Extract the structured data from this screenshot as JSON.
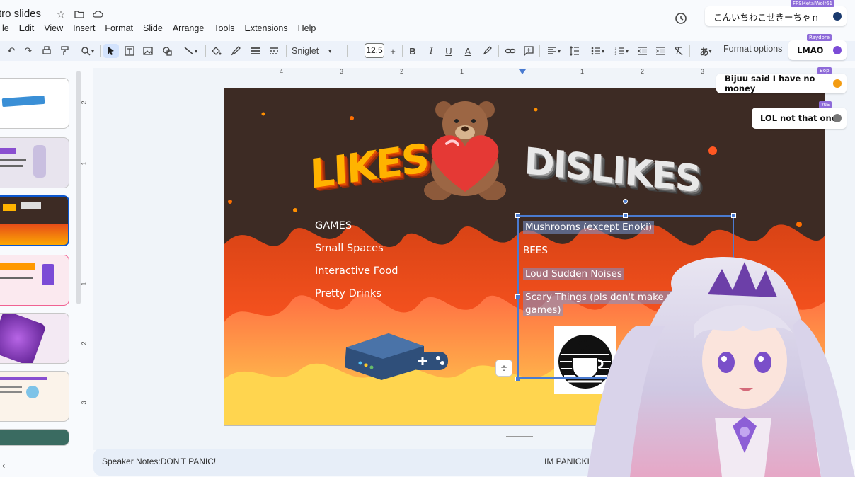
{
  "app": {
    "doc_title": "tro slides",
    "menu": [
      "le",
      "Edit",
      "View",
      "Insert",
      "Format",
      "Slide",
      "Arrange",
      "Tools",
      "Extensions",
      "Help"
    ]
  },
  "toolbar": {
    "font_name": "Sniglet",
    "font_size": "12.5",
    "format_options": "Format options",
    "input_tool_glyph": "あ"
  },
  "ruler": {
    "top_ticks": [
      "4",
      "3",
      "2",
      "1",
      "1",
      "2",
      "3"
    ],
    "left_ticks": [
      "2",
      "1",
      "1",
      "2",
      "3"
    ]
  },
  "slide": {
    "likes_title": "LIKES",
    "dislikes_title": "DISLIKES",
    "likes": [
      "GAMES",
      "Small Spaces",
      "Interactive Food",
      "Pretty Drinks"
    ],
    "dislikes": [
      "Mushrooms (except Enoki)",
      "BEES",
      "Loud Sudden Noises",
      "Scary Things (pls don't make me play",
      "games)"
    ]
  },
  "notes": {
    "label": "Speaker Notes:DON'T PANIC!",
    "tail": "IM PANICKING"
  },
  "chat": [
    {
      "user": "FPSMetalWolf61",
      "text": "こんいちわこせきーちゃｎ",
      "avatar_color": "#1a3a6e"
    },
    {
      "user": "Raydore",
      "text": "LMAO",
      "avatar_color": "#7b4bd6"
    },
    {
      "user": "Bop",
      "text": "Bijuu said I have no money",
      "avatar_color": "#f39c12"
    },
    {
      "user": "YuS",
      "text": "LOL not that one",
      "avatar_color": "#777777"
    }
  ],
  "colors": {
    "accent": "#0b57d0",
    "toolbar_bg": "#edf2fa",
    "slide_bg": "#3d2b24",
    "chat_badge": "#8e6bd9"
  }
}
